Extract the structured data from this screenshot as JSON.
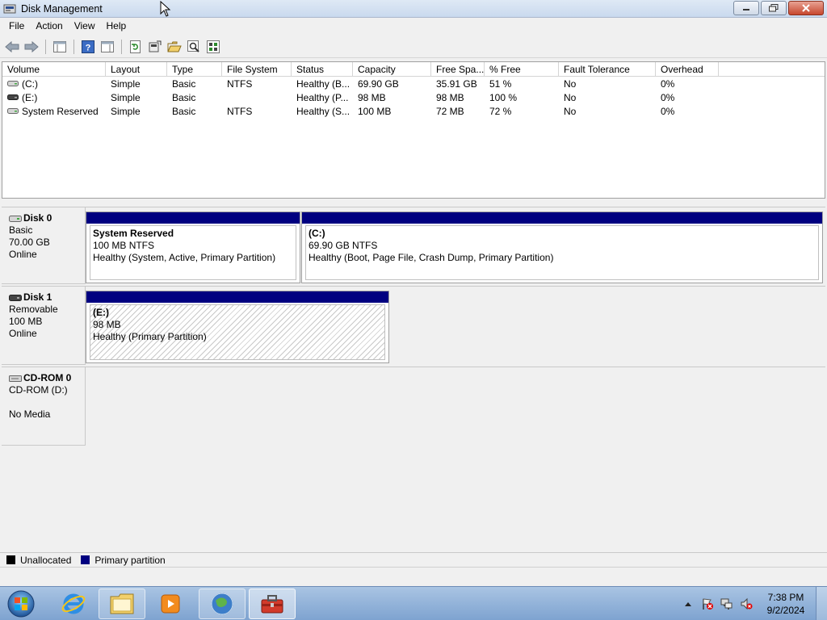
{
  "window": {
    "title": "Disk Management"
  },
  "menu": [
    "File",
    "Action",
    "View",
    "Help"
  ],
  "volume_list": {
    "columns": [
      "Volume",
      "Layout",
      "Type",
      "File System",
      "Status",
      "Capacity",
      "Free Spa...",
      "% Free",
      "Fault Tolerance",
      "Overhead"
    ],
    "rows": [
      [
        "(C:)",
        "Simple",
        "Basic",
        "NTFS",
        "Healthy (B...",
        "69.90 GB",
        "35.91 GB",
        "51 %",
        "No",
        "0%"
      ],
      [
        "(E:)",
        "Simple",
        "Basic",
        "",
        "Healthy (P...",
        "98 MB",
        "98 MB",
        "100 %",
        "No",
        "0%"
      ],
      [
        "System Reserved",
        "Simple",
        "Basic",
        "NTFS",
        "Healthy (S...",
        "100 MB",
        "72 MB",
        "72 %",
        "No",
        "0%"
      ]
    ]
  },
  "disks": [
    {
      "name": "Disk 0",
      "type": "Basic",
      "size": "70.00 GB",
      "status": "Online",
      "partitions": [
        {
          "name": "System Reserved",
          "size": "100 MB NTFS",
          "status": "Healthy (System, Active, Primary Partition)"
        },
        {
          "name": "(C:)",
          "size": "69.90 GB NTFS",
          "status": "Healthy (Boot, Page File, Crash Dump, Primary Partition)"
        }
      ]
    },
    {
      "name": "Disk 1",
      "type": "Removable",
      "size": "100 MB",
      "status": "Online",
      "partitions": [
        {
          "name": "(E:)",
          "size": "98 MB",
          "status": "Healthy (Primary Partition)"
        }
      ]
    },
    {
      "name": "CD-ROM 0",
      "type": "CD-ROM (D:)",
      "size": "",
      "status": "No Media",
      "partitions": []
    }
  ],
  "legend": [
    {
      "label": "Unallocated",
      "color": "#000000"
    },
    {
      "label": "Primary partition",
      "color": "#000080"
    }
  ],
  "taskbar": {
    "apps": [
      "internet-explorer-icon",
      "file-explorer-icon",
      "media-player-icon",
      "network-globe-icon",
      "toolbox-icon"
    ],
    "clock_time": "7:38 PM",
    "clock_date": "9/2/2024"
  }
}
